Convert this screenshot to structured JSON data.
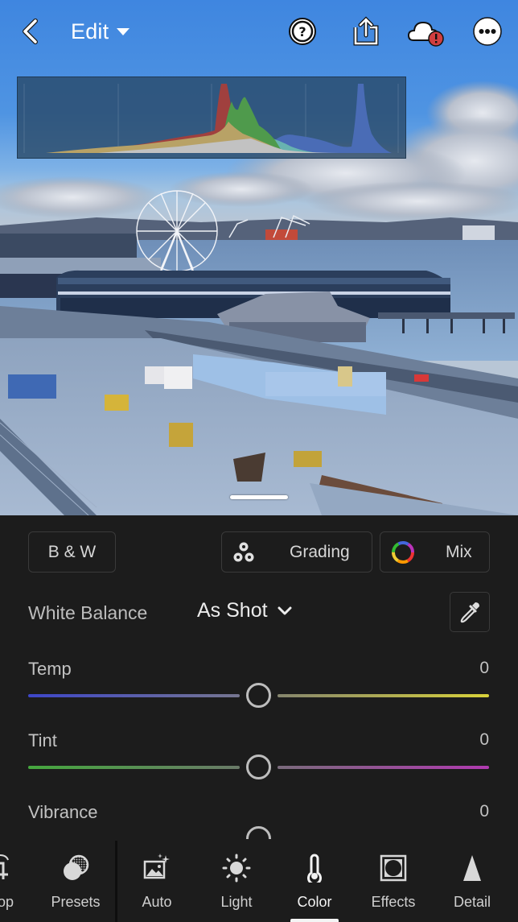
{
  "topbar": {
    "back_icon": "chevron-left-icon",
    "mode_label": "Edit",
    "icons": [
      "help-icon",
      "share-icon",
      "cloud-sync-error-icon",
      "more-icon"
    ]
  },
  "histogram": {
    "channels": [
      "red",
      "green",
      "blue",
      "luminance"
    ],
    "colors": {
      "red": "#a0403e",
      "yellow": "#b8a266",
      "green": "#4f9a4c",
      "cyan": "#68b3b0",
      "blue": "#4a6cb6",
      "gray": "#c2c2c2"
    }
  },
  "panel": {
    "bw_label": "B & W",
    "grading_label": "Grading",
    "mix_label": "Mix",
    "white_balance": {
      "label": "White Balance",
      "value": "As Shot"
    },
    "sliders": [
      {
        "label": "Temp",
        "value": "0",
        "position": 0.5,
        "colors": [
          "#3d46c9",
          "#d8d23a"
        ]
      },
      {
        "label": "Tint",
        "value": "0",
        "position": 0.5,
        "colors": [
          "#45a83e",
          "#b03ab0"
        ]
      },
      {
        "label": "Vibrance",
        "value": "0",
        "position": 0.5
      }
    ]
  },
  "toolbar": {
    "items": [
      {
        "label": "Crop",
        "icon": "crop-icon",
        "visible_label": "op"
      },
      {
        "label": "Presets",
        "icon": "presets-icon"
      },
      {
        "label": "Auto",
        "icon": "auto-icon"
      },
      {
        "label": "Light",
        "icon": "light-icon"
      },
      {
        "label": "Color",
        "icon": "color-icon",
        "active": true
      },
      {
        "label": "Effects",
        "icon": "effects-icon"
      },
      {
        "label": "Detail",
        "icon": "detail-icon"
      }
    ]
  }
}
